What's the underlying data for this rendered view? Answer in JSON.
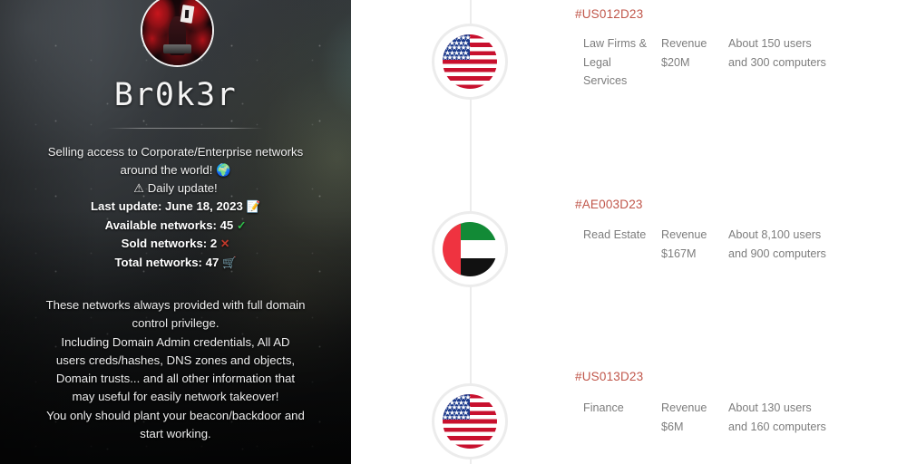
{
  "profile": {
    "avatar_alt": "hacker-avatar",
    "handle": "Br0k3r",
    "pitch_lines": [
      "Selling access to Corporate/Enterprise networks",
      "around the world! 🌍",
      "⚠ Daily update!"
    ],
    "stats": [
      {
        "label": "Last update: June 18, 2023",
        "icon": "📝",
        "icon_name": "edit-icon"
      },
      {
        "label": "Available networks: 45",
        "icon": "✓",
        "icon_name": "check-icon"
      },
      {
        "label": "Sold networks: 2",
        "icon": "✕",
        "icon_name": "cross-icon"
      },
      {
        "label": "Total networks: 47",
        "icon": "🛒",
        "icon_name": "cart-icon"
      }
    ],
    "terms_lines": [
      "These networks always provided with full domain",
      "control privilege.",
      "Including Domain Admin credentials, All AD",
      "users creds/hashes, DNS zones and objects,",
      "Domain trusts... and all other information that",
      "may useful for easily network takeover!",
      "You only should plant your beacon/backdoor and",
      "start working."
    ]
  },
  "colors": {
    "listing_id": "#c0564a",
    "detail_text": "#7d7d7d",
    "timeline_line": "#ececec",
    "flag_ring": "#ececec",
    "panel_background": "#ffffff",
    "check_green": "#2fbf4a",
    "cross_red": "#c0392b"
  },
  "listings": [
    {
      "id": "#US012D23",
      "flag": "us",
      "flag_name": "flag-united-states",
      "industry": "Law Firms & Legal Services",
      "revenue_label": "Revenue",
      "revenue_value": "$20M",
      "size": "About 150 users and 300 computers"
    },
    {
      "id": "#AE003D23",
      "flag": "ae",
      "flag_name": "flag-united-arab-emirates",
      "industry": "Read Estate",
      "revenue_label": "Revenue",
      "revenue_value": "$167M",
      "size": "About 8,100 users and 900 computers"
    },
    {
      "id": "#US013D23",
      "flag": "us",
      "flag_name": "flag-united-states",
      "industry": "Finance",
      "revenue_label": "Revenue",
      "revenue_value": "$6M",
      "size": "About 130 users and 160 computers"
    }
  ]
}
